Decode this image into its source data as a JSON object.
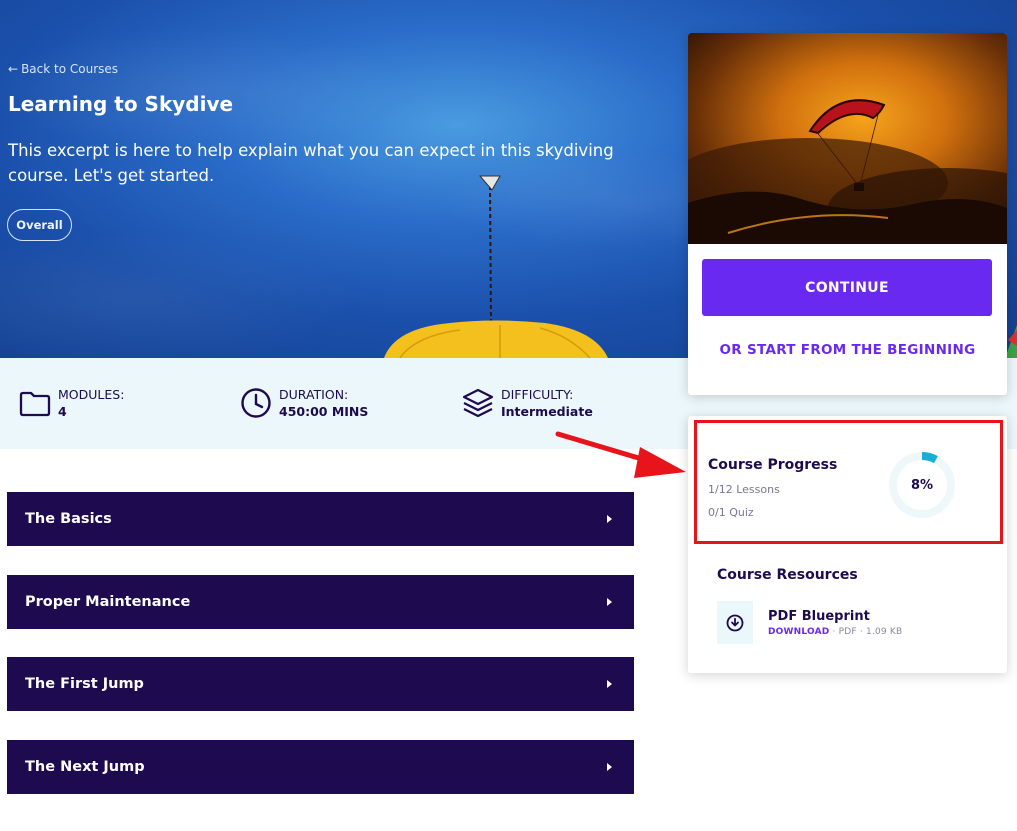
{
  "hero": {
    "back_label": "Back to Courses",
    "title": "Learning to Skydive",
    "excerpt": "This excerpt is here to help explain what you can expect in this skydiving course. Let's get started.",
    "category_pill": "Overall"
  },
  "info_bar": {
    "modules": {
      "label": "MODULES:",
      "value": "4",
      "icon": "folder-icon"
    },
    "duration": {
      "label": "DURATION:",
      "value": "450:00 MINS",
      "icon": "clock-icon"
    },
    "difficulty": {
      "label": "DIFFICULTY:",
      "value": "Intermediate",
      "icon": "layers-icon"
    }
  },
  "modules": [
    {
      "title": "The Basics"
    },
    {
      "title": "Proper Maintenance"
    },
    {
      "title": "The First Jump"
    },
    {
      "title": "The Next Jump"
    }
  ],
  "sidebar": {
    "continue_label": "CONTINUE",
    "restart_label": "OR START FROM THE BEGINNING",
    "progress": {
      "title": "Course Progress",
      "lessons": "1/12 Lessons",
      "quiz": "0/1 Quiz",
      "percent_label": "8%",
      "percent_value": 8
    },
    "resources": {
      "title": "Course Resources",
      "items": [
        {
          "name": "PDF Blueprint",
          "action": "DOWNLOAD",
          "meta": " · PDF · 1.09 KB"
        }
      ]
    }
  },
  "colors": {
    "navy": "#1e0a4e",
    "accent": "#6a29f0",
    "ring": "#1aaed6",
    "highlight": "#e8141c"
  }
}
